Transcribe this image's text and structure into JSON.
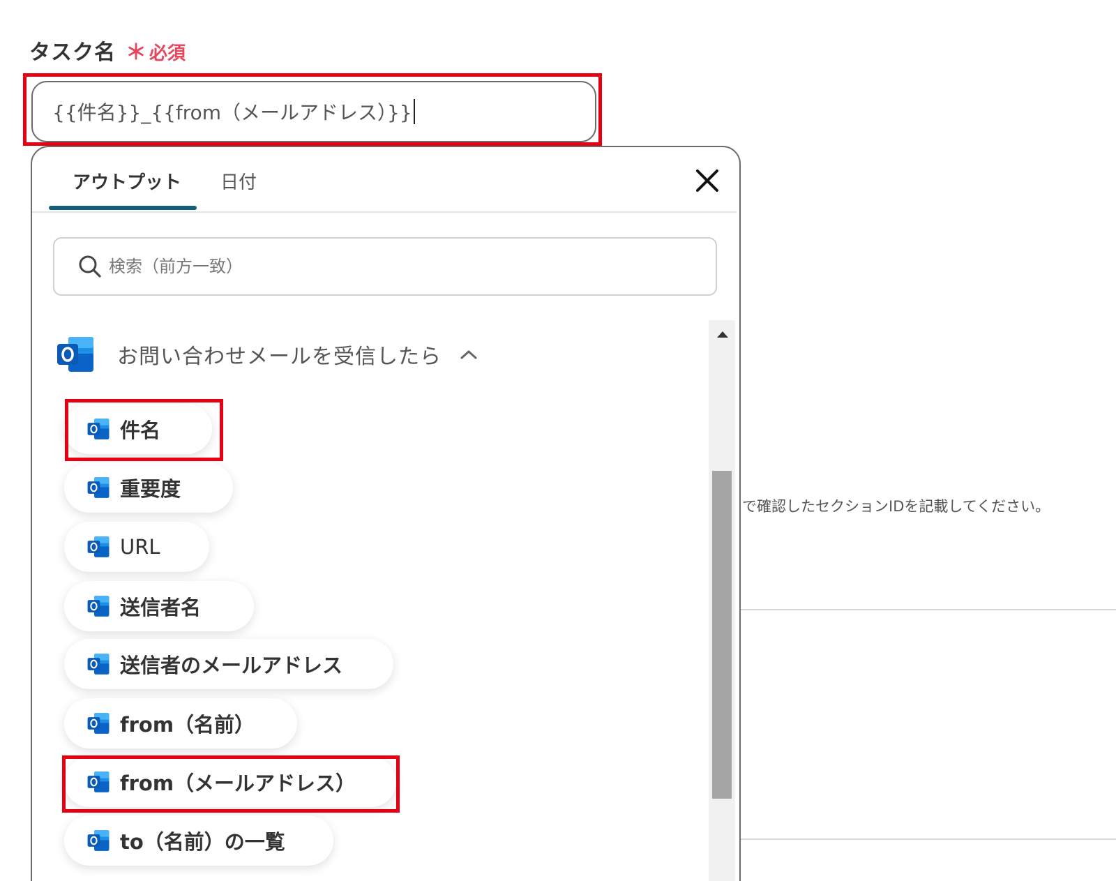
{
  "field": {
    "label": "タスク名",
    "required_star": "＊",
    "required_text": "必須",
    "value": "{{件名}}_{{from（メールアドレス）}}"
  },
  "background": {
    "helper_text": "で確認したセクションIDを記載してください。"
  },
  "popup": {
    "tabs": [
      {
        "label": "アウトプット",
        "active": true
      },
      {
        "label": "日付",
        "active": false
      }
    ],
    "close_icon": "close-icon",
    "search": {
      "placeholder": "検索（前方一致）",
      "icon": "search-icon"
    },
    "group": {
      "title": "お問い合わせメールを受信したら",
      "icon": "outlook-icon",
      "expanded": true
    },
    "items": [
      {
        "label": "件名",
        "icon": "outlook-icon",
        "highlighted": true
      },
      {
        "label": "重要度",
        "icon": "outlook-icon",
        "highlighted": false
      },
      {
        "label": "URL",
        "icon": "outlook-icon",
        "highlighted": false
      },
      {
        "label": "送信者名",
        "icon": "outlook-icon",
        "highlighted": false
      },
      {
        "label": "送信者のメールアドレス",
        "icon": "outlook-icon",
        "highlighted": false
      },
      {
        "label": "from（名前）",
        "icon": "outlook-icon",
        "highlighted": false
      },
      {
        "label": "from（メールアドレス）",
        "icon": "outlook-icon",
        "highlighted": true
      },
      {
        "label": "to（名前）の一覧",
        "icon": "outlook-icon",
        "highlighted": false
      }
    ]
  },
  "colors": {
    "highlight": "#e60012",
    "required": "#e5485e",
    "tab_underline": "#135f7a",
    "outlook_blue": "#0a64c8"
  }
}
